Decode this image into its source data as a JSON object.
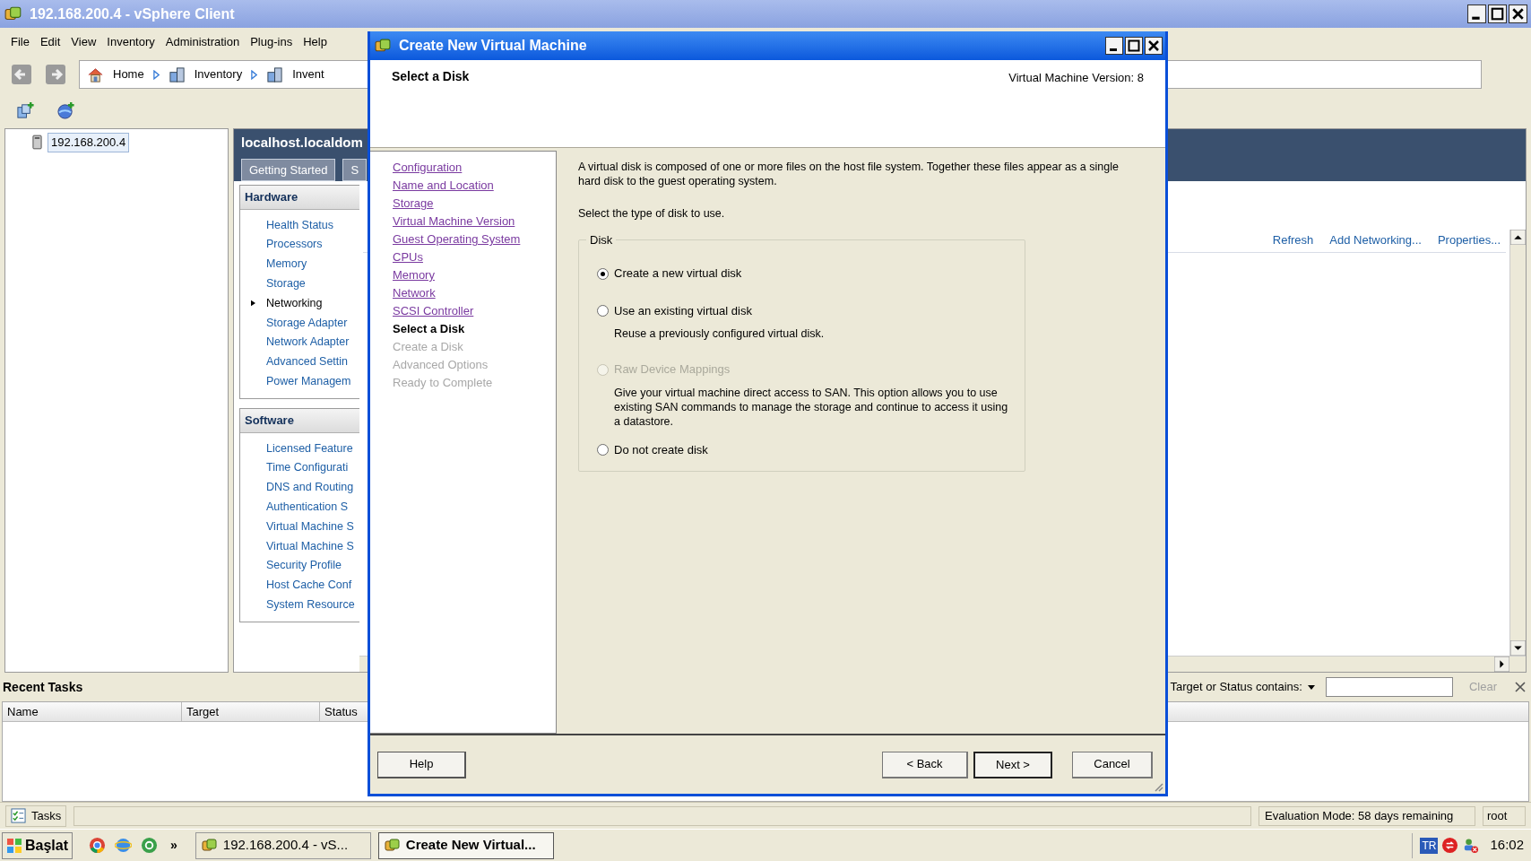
{
  "main_window": {
    "title": "192.168.200.4 - vSphere Client",
    "menu": [
      "File",
      "Edit",
      "View",
      "Inventory",
      "Administration",
      "Plug-ins",
      "Help"
    ],
    "breadcrumb": [
      "Home",
      "Inventory",
      "Invent"
    ],
    "tree": [
      {
        "label": "192.168.200.4",
        "selected": true
      }
    ],
    "host_panel": {
      "title": "localhost.localdom",
      "tabs": [
        "Getting Started",
        "S"
      ],
      "sections": [
        {
          "title": "Hardware",
          "items": [
            {
              "label": "Health Status",
              "selected": false
            },
            {
              "label": "Processors",
              "selected": false
            },
            {
              "label": "Memory",
              "selected": false
            },
            {
              "label": "Storage",
              "selected": false
            },
            {
              "label": "Networking",
              "selected": true
            },
            {
              "label": "Storage Adapter",
              "selected": false
            },
            {
              "label": "Network Adapter",
              "selected": false
            },
            {
              "label": "Advanced Settin",
              "selected": false
            },
            {
              "label": "Power Managem",
              "selected": false
            }
          ]
        },
        {
          "title": "Software",
          "items": [
            {
              "label": "Licensed Feature",
              "selected": false
            },
            {
              "label": "Time Configurati",
              "selected": false
            },
            {
              "label": "DNS and Routing",
              "selected": false
            },
            {
              "label": "Authentication S",
              "selected": false
            },
            {
              "label": "Virtual Machine S",
              "selected": false
            },
            {
              "label": "Virtual Machine S",
              "selected": false
            },
            {
              "label": "Security Profile",
              "selected": false
            },
            {
              "label": "Host Cache Conf",
              "selected": false
            },
            {
              "label": "System Resource",
              "selected": false
            }
          ]
        }
      ],
      "actions": [
        "Refresh",
        "Add Networking...",
        "Properties..."
      ]
    },
    "recent_tasks": {
      "title": "Recent Tasks",
      "filter_label": "Target or Status contains:",
      "clear": "Clear",
      "columns": [
        "Name",
        "Target",
        "Status"
      ]
    },
    "status_bar": {
      "tasks": "Tasks",
      "evaluation": "Evaluation Mode: 58 days remaining",
      "user": "root"
    }
  },
  "dialog": {
    "title": "Create New Virtual Machine",
    "heading": "Select a Disk",
    "version": "Virtual Machine Version: 8",
    "steps": [
      {
        "label": "Configuration",
        "selected": false,
        "disabled": false
      },
      {
        "label": "Name and Location",
        "selected": false,
        "disabled": false
      },
      {
        "label": "Storage",
        "selected": false,
        "disabled": false
      },
      {
        "label": "Virtual Machine Version",
        "selected": false,
        "disabled": false
      },
      {
        "label": "Guest Operating System",
        "selected": false,
        "disabled": false
      },
      {
        "label": "CPUs",
        "selected": false,
        "disabled": false
      },
      {
        "label": "Memory",
        "selected": false,
        "disabled": false
      },
      {
        "label": "Network",
        "selected": false,
        "disabled": false
      },
      {
        "label": "SCSI Controller",
        "selected": false,
        "disabled": false
      },
      {
        "label": "Select a Disk",
        "selected": true,
        "disabled": false
      },
      {
        "label": "Create a Disk",
        "selected": false,
        "disabled": true
      },
      {
        "label": "Advanced Options",
        "selected": false,
        "disabled": true
      },
      {
        "label": "Ready to Complete",
        "selected": false,
        "disabled": true
      }
    ],
    "intro": "A virtual disk is composed of one or more files on the host file system. Together these files appear as a single hard disk to the guest operating system.",
    "prompt": "Select the type of disk to use.",
    "group": "Disk",
    "options": [
      {
        "label": "Create a new virtual disk",
        "selected": true,
        "disabled": false
      },
      {
        "label": "Use an existing virtual disk",
        "description": "Reuse a previously configured virtual disk.",
        "selected": false,
        "disabled": false
      },
      {
        "label": "Raw Device Mappings",
        "description": "Give your virtual machine direct access to SAN. This option allows you to use existing SAN commands to manage the storage and continue to access it using a datastore.",
        "selected": false,
        "disabled": true
      },
      {
        "label": "Do not create disk",
        "selected": false,
        "disabled": false
      }
    ],
    "buttons": {
      "help": "Help",
      "back": "< Back",
      "next": "Next >",
      "cancel": "Cancel"
    }
  },
  "taskbar": {
    "start": "Başlat",
    "more": "»",
    "tasks": [
      {
        "label": "192.168.200.4 - vS...",
        "selected": false
      },
      {
        "label": "Create New Virtual...",
        "selected": true
      }
    ],
    "tray_language": "TR",
    "clock": "16:02"
  }
}
